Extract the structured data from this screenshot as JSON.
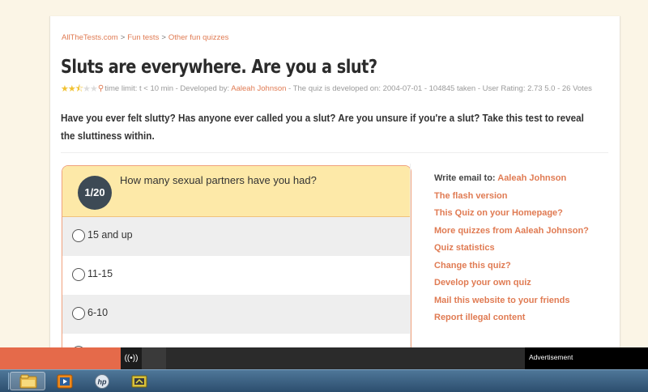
{
  "breadcrumb": {
    "home": "AllTheTests.com",
    "section": "Fun tests",
    "subsection": "Other fun quizzes",
    "separator": ">"
  },
  "quiz": {
    "title": "Sluts are everywhere. Are you a slut?",
    "rating_stars": 2.5,
    "meta_prefix": "time limit: t < 10 min - Developed by: ",
    "author": "Aaleah Johnson",
    "meta_suffix": " - The quiz is developed on: 2004-07-01 - 104845 taken - User Rating: 2.73 5.0 - 26 Votes",
    "description": "Have you ever felt slutty? Has anyone ever called you a slut? Are you unsure if you're a slut? Take this test to reveal the sluttiness within."
  },
  "question": {
    "counter": "1/20",
    "text": "How many sexual partners have you had?",
    "options": [
      "15 and up",
      "11-15",
      "6-10"
    ]
  },
  "sidebar": {
    "email_prefix": "Write email to: ",
    "email_author": "Aaleah Johnson",
    "links": [
      "The flash version",
      "This Quiz on your Homepage?",
      "More quizzes from Aaleah Johnson?",
      "Quiz statistics",
      "Change this quiz?",
      "Develop your own quiz",
      "Mail this website to your friends",
      "Report illegal content"
    ]
  },
  "ad_bar": {
    "cast_icon": "((•))",
    "label": "Advertisement"
  },
  "taskbar": {
    "apps": [
      "file-explorer-icon",
      "media-player-icon",
      "hp-icon",
      "tool-app-icon"
    ]
  },
  "colors": {
    "accent": "#e07b53",
    "question_bg": "#fde9a8",
    "badge": "#3d4a55",
    "background": "#fbf5e6"
  }
}
